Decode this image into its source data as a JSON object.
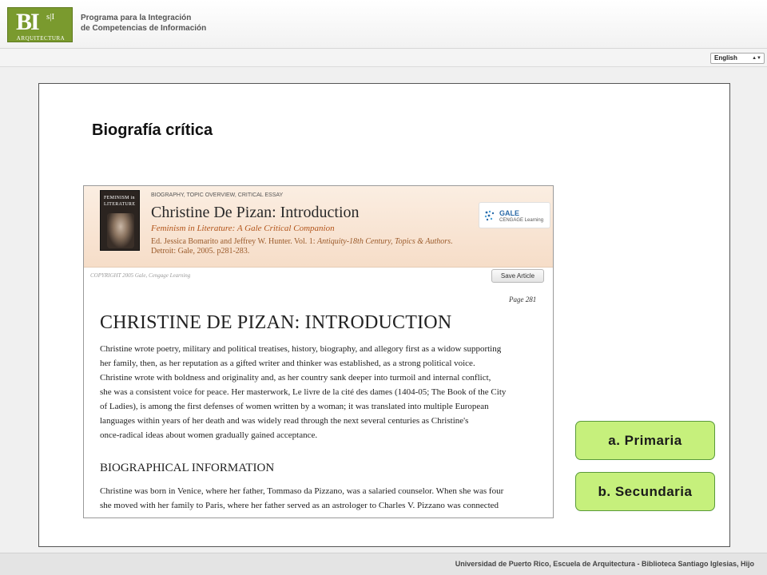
{
  "header": {
    "logo": {
      "monogram": "BI",
      "monogram_small": "s|I",
      "sub": "ARQUITECTURA"
    },
    "program_title_line1": "Programa para la Integración",
    "program_title_line2": "de Competencias de Información"
  },
  "language": {
    "selected": "English"
  },
  "main": {
    "heading": "Biografía crítica",
    "article": {
      "book_cover_line1": "FEMINISM in",
      "book_cover_line2": "LITERATURE",
      "category": "BIOGRAPHY, TOPIC OVERVIEW, CRITICAL ESSAY",
      "title": "Christine De Pizan: Introduction",
      "source": "Feminism in Literature: A Gale Critical Companion",
      "citation_prefix": "Ed. Jessica Bomarito and Jeffrey W. Hunter. Vol. 1: ",
      "citation_italic": "Antiquity-18th Century, Topics & Authors",
      "citation_suffix": ". Detroit: Gale, 2005. p281-283.",
      "publisher_badge_line1": "GALE",
      "publisher_badge_line2": "CENGAGE Learning",
      "copyright": "COPYRIGHT 2005 Gale, Cengage Learning",
      "save_button": "Save Article",
      "page_number": "Page 281",
      "heading": "CHRISTINE DE PIZAN: INTRODUCTION",
      "paragraph1_lines": [
        "Christine wrote poetry, military and political treatises, history, biography, and allegory first as a widow supporting",
        "her family, then, as her reputation as a gifted writer and thinker was established, as a strong political voice.",
        "Christine wrote with boldness and originality and, as her country sank deeper into turmoil and internal conflict,",
        "she was a consistent voice for peace. Her masterwork, Le livre de la cité des dames (1404-05; The Book of the City",
        "of Ladies), is among the first defenses of women written by a woman; it was translated into multiple European",
        "languages within years of her death and was widely read through the next several centuries as Christine's",
        "once-radical ideas about women gradually gained acceptance."
      ],
      "section_heading": "BIOGRAPHICAL INFORMATION",
      "paragraph2_lines": [
        "Christine was born in Venice, where her father, Tommaso da Pizzano, was a salaried counselor. When she was four",
        "she moved with her family to Paris, where her father served as an astrologer to Charles V. Pizzano was connected"
      ]
    }
  },
  "answers": [
    {
      "label": "a. Primaria"
    },
    {
      "label": "b. Secundaria"
    }
  ],
  "footer": {
    "text": "Universidad de Puerto Rico, Escuela de Arquitectura - Biblioteca Santiago Iglesias, Hijo"
  },
  "colors": {
    "answer_fill": "#c6f07c",
    "answer_border": "#5a9a3a",
    "logo_green": "#7a9a2e",
    "article_title_accent": "#b2541a"
  }
}
